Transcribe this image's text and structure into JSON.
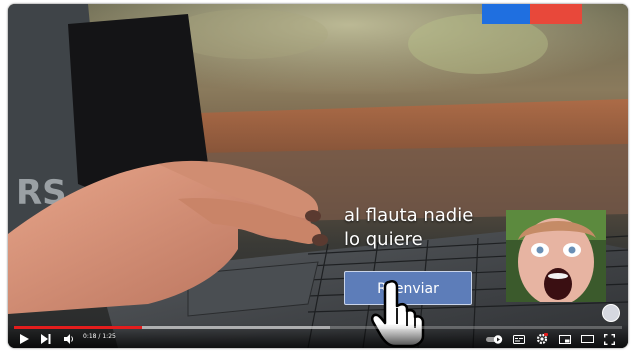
{
  "video": {
    "caption_lines": [
      "al flauta nadie",
      "lo quiere"
    ],
    "button_label": "Reenviar",
    "time_current": "0:18",
    "time_separator": "/",
    "time_total": "1:25",
    "progress_played": 0.21,
    "progress_loaded": 0.52
  },
  "colors": {
    "flag_blue": "#1f6fe0",
    "flag_red": "#e8483a",
    "button_bg": "#5d7db9",
    "progress_red": "#e41d1d"
  },
  "icons": {
    "play": "play-icon",
    "next": "next-icon",
    "volume": "volume-icon",
    "autoplay": "autoplay-toggle-icon",
    "subtitles": "subtitles-icon",
    "settings": "gear-icon",
    "miniplayer": "miniplayer-icon",
    "theater": "theater-icon",
    "fullscreen": "fullscreen-icon",
    "cursor": "hand-pointer-icon",
    "channel": "channel-watermark-icon"
  }
}
